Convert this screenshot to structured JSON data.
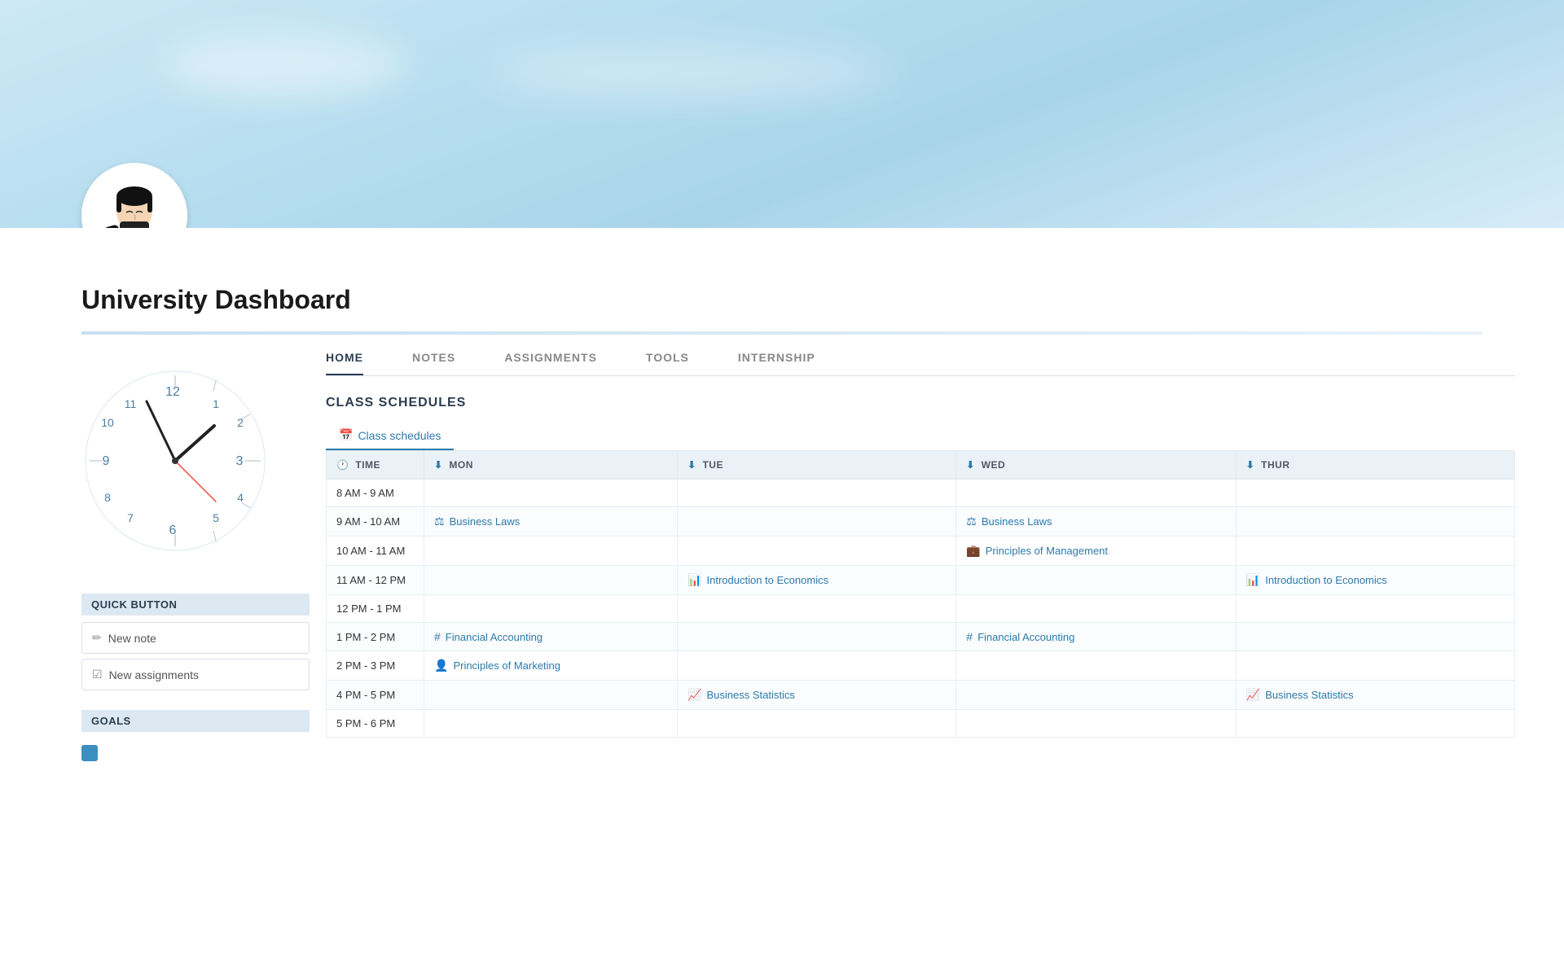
{
  "hero": {
    "alt": "Sky background"
  },
  "avatar": {
    "alt": "Student reading avatar"
  },
  "page": {
    "title": "University Dashboard"
  },
  "sidebar": {
    "quick_button_label": "QUICK BUTTON",
    "new_note_label": "New note",
    "new_assignments_label": "New assignments",
    "goals_label": "GOALS"
  },
  "nav": {
    "tabs": [
      {
        "id": "home",
        "label": "HOME",
        "active": true
      },
      {
        "id": "notes",
        "label": "NOTES",
        "active": false
      },
      {
        "id": "assignments",
        "label": "ASSIGNMENTS",
        "active": false
      },
      {
        "id": "tools",
        "label": "TOOLS",
        "active": false
      },
      {
        "id": "internship",
        "label": "INTERNSHIP",
        "active": false
      }
    ]
  },
  "schedule": {
    "section_title": "CLASS SCHEDULES",
    "tab_label": "Class schedules",
    "columns": [
      {
        "id": "time",
        "label": "TIME",
        "icon": "🕐"
      },
      {
        "id": "mon",
        "label": "MON",
        "icon": "⬇"
      },
      {
        "id": "tue",
        "label": "TUE",
        "icon": "⬇"
      },
      {
        "id": "wed",
        "label": "WED",
        "icon": "⬇"
      },
      {
        "id": "thur",
        "label": "THUR",
        "icon": "⬇"
      }
    ],
    "rows": [
      {
        "time": "8 AM - 9 AM",
        "mon": null,
        "tue": null,
        "wed": null,
        "thur": null
      },
      {
        "time": "9 AM - 10 AM",
        "mon": {
          "label": "Business Laws",
          "icon": "⚖"
        },
        "tue": null,
        "wed": {
          "label": "Business Laws",
          "icon": "⚖"
        },
        "thur": null
      },
      {
        "time": "10 AM - 11 AM",
        "mon": null,
        "tue": null,
        "wed": {
          "label": "Principles of Management",
          "icon": "💼"
        },
        "thur": null
      },
      {
        "time": "11 AM - 12 PM",
        "mon": null,
        "tue": {
          "label": "Introduction to Economics",
          "icon": "📊"
        },
        "wed": null,
        "thur": {
          "label": "Introduction to Economics",
          "icon": "📊"
        }
      },
      {
        "time": "12 PM - 1 PM",
        "mon": null,
        "tue": null,
        "wed": null,
        "thur": null
      },
      {
        "time": "1 PM - 2 PM",
        "mon": {
          "label": "Financial Accounting",
          "icon": "#"
        },
        "tue": null,
        "wed": {
          "label": "Financial Accounting",
          "icon": "#"
        },
        "thur": null
      },
      {
        "time": "2 PM - 3 PM",
        "mon": {
          "label": "Principles of Marketing",
          "icon": "👤"
        },
        "tue": null,
        "wed": null,
        "thur": null
      },
      {
        "time": "4 PM - 5 PM",
        "mon": null,
        "tue": {
          "label": "Business Statistics",
          "icon": "📈"
        },
        "wed": null,
        "thur": {
          "label": "Business Statistics",
          "icon": "📈"
        }
      },
      {
        "time": "5 PM - 6 PM",
        "mon": null,
        "tue": null,
        "wed": null,
        "thur": null
      }
    ]
  },
  "clock": {
    "hour_hand_angle": 60,
    "minute_hand_angle": 350,
    "second_hand_angle": 120
  }
}
